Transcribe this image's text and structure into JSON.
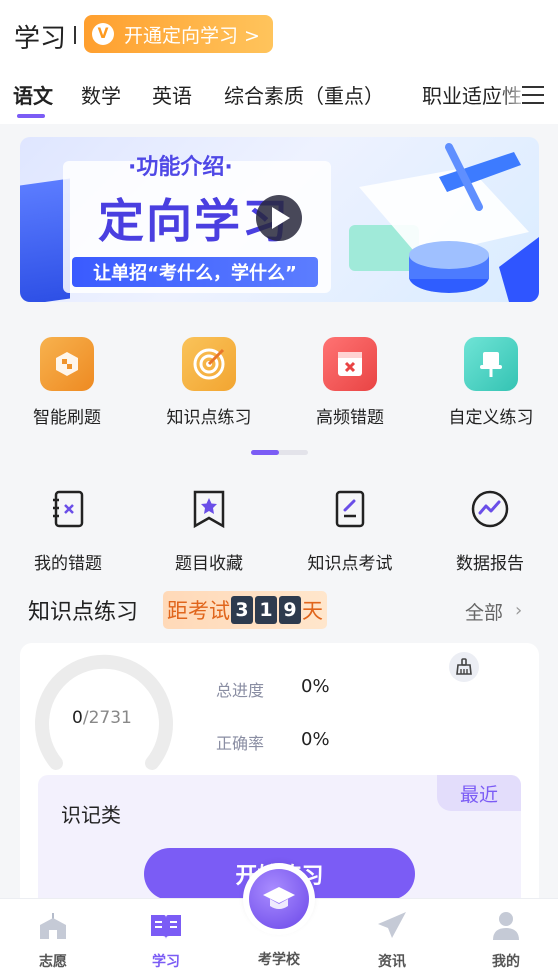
{
  "header": {
    "title": "学习",
    "promo_icon": "V",
    "promo_label": "开通定向学习 >"
  },
  "tabs": [
    {
      "label": "语文",
      "active": true
    },
    {
      "label": "数学",
      "active": false
    },
    {
      "label": "英语",
      "active": false
    },
    {
      "label": "综合素质（重点）",
      "active": false
    },
    {
      "label": "职业适应性",
      "active": false
    }
  ],
  "banner": {
    "kicker": "·功能介绍·",
    "title": "定向学习",
    "subtitle": "让单招“考什么，学什么”"
  },
  "functions": [
    {
      "label": "智能刷题",
      "icon": "smart-practice-icon",
      "color": "#f3a13a"
    },
    {
      "label": "知识点练习",
      "icon": "target-icon",
      "color": "#f6b849"
    },
    {
      "label": "高频错题",
      "icon": "error-book-icon",
      "color": "#f25b5b"
    },
    {
      "label": "自定义练习",
      "icon": "pin-icon",
      "color": "#4fd6c6"
    }
  ],
  "tools": [
    {
      "label": "我的错题",
      "icon": "wrong-notebook-icon"
    },
    {
      "label": "题目收藏",
      "icon": "bookmark-star-icon"
    },
    {
      "label": "知识点考试",
      "icon": "exam-paper-icon"
    },
    {
      "label": "数据报告",
      "icon": "trend-chart-icon"
    }
  ],
  "section": {
    "title": "知识点练习",
    "countdown_prefix": "距考试",
    "countdown_digits": [
      "3",
      "1",
      "9"
    ],
    "countdown_suffix": "天",
    "all_label": "全部",
    "all_chevron": "›"
  },
  "card": {
    "progress_done": "0",
    "progress_sep": "/",
    "progress_total": "2731",
    "progress_fraction": 0,
    "stats": [
      {
        "label": "总进度",
        "value": "0%"
      },
      {
        "label": "正确率",
        "value": "0%"
      }
    ],
    "recent_tag": "最近",
    "category": "识记类",
    "start_label": "开始练习"
  },
  "nav": [
    {
      "label": "志愿",
      "icon": "school-building-icon",
      "active": false
    },
    {
      "label": "学习",
      "icon": "book-icon",
      "active": true
    },
    {
      "label": "考学校",
      "icon": "graduation-cap-icon",
      "active": false
    },
    {
      "label": "资讯",
      "icon": "paper-plane-icon",
      "active": false
    },
    {
      "label": "我的",
      "icon": "user-icon",
      "active": false
    }
  ],
  "colors": {
    "accent": "#7b5cf5",
    "promo": "#ff9f2e",
    "countdown_text": "#e0651c"
  }
}
